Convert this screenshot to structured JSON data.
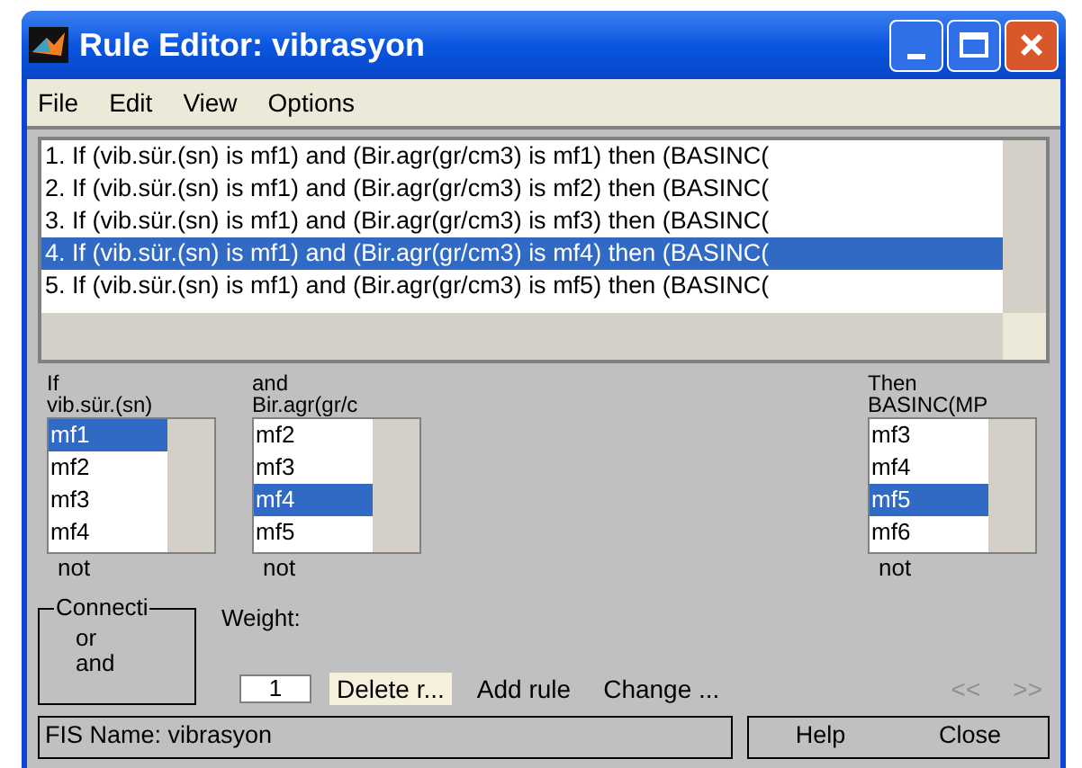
{
  "window": {
    "title": "Rule Editor: vibrasyon"
  },
  "menu": [
    "File",
    "Edit",
    "View",
    "Options"
  ],
  "rules": [
    {
      "text": "1. If (vib.sür.(sn) is mf1) and (Bir.agr(gr/cm3) is mf1) then (BASINC(",
      "selected": false
    },
    {
      "text": "2. If (vib.sür.(sn) is mf1) and (Bir.agr(gr/cm3) is mf2) then (BASINC(",
      "selected": false
    },
    {
      "text": "3. If (vib.sür.(sn) is mf1) and (Bir.agr(gr/cm3) is mf3) then (BASINC(",
      "selected": false
    },
    {
      "text": "4. If (vib.sür.(sn) is mf1) and (Bir.agr(gr/cm3) is mf4) then (BASINC(",
      "selected": true
    },
    {
      "text": "5. If (vib.sür.(sn) is mf1) and (Bir.agr(gr/cm3) is mf5) then (BASINC(",
      "selected": false
    }
  ],
  "variables": [
    {
      "kind": "input",
      "heading": "If",
      "name": "vib.sür.(sn)",
      "items": [
        {
          "label": "mf1",
          "selected": true
        },
        {
          "label": "mf2",
          "selected": false
        },
        {
          "label": "mf3",
          "selected": false
        },
        {
          "label": "mf4",
          "selected": false
        }
      ],
      "not_label": "not"
    },
    {
      "kind": "input",
      "heading": "and",
      "name": "Bir.agr(gr/c",
      "items": [
        {
          "label": "mf2",
          "selected": false
        },
        {
          "label": "mf3",
          "selected": false
        },
        {
          "label": "mf4",
          "selected": true
        },
        {
          "label": "mf5",
          "selected": false
        }
      ],
      "not_label": "not"
    },
    {
      "kind": "output",
      "heading": "Then",
      "name": "BASINC(MP",
      "items": [
        {
          "label": "mf3",
          "selected": false
        },
        {
          "label": "mf4",
          "selected": false
        },
        {
          "label": "mf5",
          "selected": true
        },
        {
          "label": "mf6",
          "selected": false
        }
      ],
      "not_label": "not"
    }
  ],
  "connection": {
    "title": "Connecti",
    "options": [
      "or",
      "and"
    ]
  },
  "weight": {
    "label": "Weight:",
    "value": "1"
  },
  "buttons": [
    {
      "label": "Delete r...",
      "focused": true,
      "disabled": false
    },
    {
      "label": "Add rule",
      "focused": false,
      "disabled": false
    },
    {
      "label": "Change ...",
      "focused": false,
      "disabled": false
    },
    {
      "label": "<<",
      "focused": false,
      "disabled": true
    },
    {
      "label": ">>",
      "focused": false,
      "disabled": true
    }
  ],
  "status_bar": {
    "text": "FIS Name: vibrasyon",
    "buttons": [
      "Help",
      "Close"
    ]
  }
}
